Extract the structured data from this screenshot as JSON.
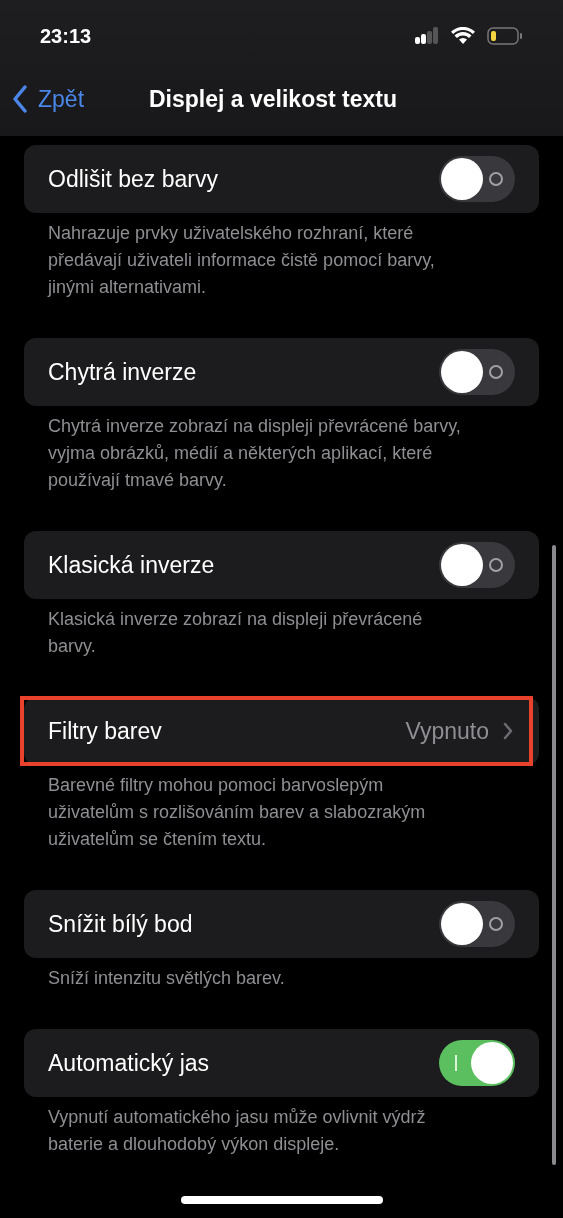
{
  "status_bar": {
    "time": "23:13"
  },
  "nav": {
    "back": "Zpět",
    "title": "Displej a velikost textu"
  },
  "sections": [
    {
      "kind": "toggle",
      "label": "Odlišit bez barvy",
      "on": false,
      "highlighted": false,
      "footer": "Nahrazuje prvky uživatelského rozhraní, které předávají uživateli informace čistě pomocí barvy, jinými alternativami."
    },
    {
      "kind": "toggle",
      "label": "Chytrá inverze",
      "on": false,
      "highlighted": false,
      "footer": "Chytrá inverze zobrazí na displeji převrácené barvy, vyjma obrázků, médií a některých aplikací, které používají tmavé barvy."
    },
    {
      "kind": "toggle",
      "label": "Klasická inverze",
      "on": false,
      "highlighted": false,
      "footer": "Klasická inverze zobrazí na displeji převrácené barvy."
    },
    {
      "kind": "link",
      "label": "Filtry barev",
      "value": "Vypnuto",
      "highlighted": true,
      "footer": "Barevné filtry mohou pomoci barvoslepým uživatelům s rozlišováním barev a slabozrakým uživatelům se čtením textu."
    },
    {
      "kind": "toggle",
      "label": "Snížit bílý bod",
      "on": false,
      "highlighted": false,
      "footer": "Sníží intenzitu světlých barev."
    },
    {
      "kind": "toggle",
      "label": "Automatický jas",
      "on": true,
      "highlighted": false,
      "footer": "Vypnutí automatického jasu může ovlivnit výdrž baterie a dlouhodobý výkon displeje."
    }
  ]
}
